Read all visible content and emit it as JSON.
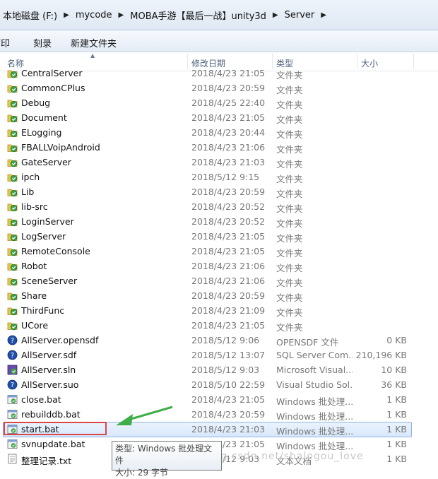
{
  "breadcrumb": [
    "本地磁盘 (F:)",
    "mycode",
    "MOBA手游【最后一战】unity3d",
    "Server"
  ],
  "toolbar": {
    "print": "打印",
    "burn": "刻录",
    "new_folder": "新建文件夹"
  },
  "columns": {
    "name": "名称",
    "date": "修改日期",
    "type": "类型",
    "size": "大小"
  },
  "files": [
    {
      "name": "CentralServer",
      "date": "2018/4/23 21:05",
      "type": "文件夹",
      "size": "",
      "icon": "folder-icon"
    },
    {
      "name": "CommonCPlus",
      "date": "2018/4/23 20:59",
      "type": "文件夹",
      "size": "",
      "icon": "folder-icon"
    },
    {
      "name": "Debug",
      "date": "2018/4/25 22:40",
      "type": "文件夹",
      "size": "",
      "icon": "folder-icon"
    },
    {
      "name": "Document",
      "date": "2018/4/23 21:05",
      "type": "文件夹",
      "size": "",
      "icon": "folder-icon"
    },
    {
      "name": "ELogging",
      "date": "2018/4/23 20:44",
      "type": "文件夹",
      "size": "",
      "icon": "folder-icon"
    },
    {
      "name": "FBALLVoipAndroid",
      "date": "2018/4/23 21:06",
      "type": "文件夹",
      "size": "",
      "icon": "folder-icon"
    },
    {
      "name": "GateServer",
      "date": "2018/4/23 21:03",
      "type": "文件夹",
      "size": "",
      "icon": "folder-icon"
    },
    {
      "name": "ipch",
      "date": "2018/5/12 9:15",
      "type": "文件夹",
      "size": "",
      "icon": "folder-icon"
    },
    {
      "name": "Lib",
      "date": "2018/4/23 20:59",
      "type": "文件夹",
      "size": "",
      "icon": "folder-icon"
    },
    {
      "name": "lib-src",
      "date": "2018/4/23 20:52",
      "type": "文件夹",
      "size": "",
      "icon": "folder-icon"
    },
    {
      "name": "LoginServer",
      "date": "2018/4/23 20:52",
      "type": "文件夹",
      "size": "",
      "icon": "folder-icon"
    },
    {
      "name": "LogServer",
      "date": "2018/4/23 21:05",
      "type": "文件夹",
      "size": "",
      "icon": "folder-icon"
    },
    {
      "name": "RemoteConsole",
      "date": "2018/4/23 21:05",
      "type": "文件夹",
      "size": "",
      "icon": "folder-icon"
    },
    {
      "name": "Robot",
      "date": "2018/4/23 21:06",
      "type": "文件夹",
      "size": "",
      "icon": "folder-icon"
    },
    {
      "name": "SceneServer",
      "date": "2018/4/23 21:06",
      "type": "文件夹",
      "size": "",
      "icon": "folder-icon"
    },
    {
      "name": "Share",
      "date": "2018/4/23 20:59",
      "type": "文件夹",
      "size": "",
      "icon": "folder-icon"
    },
    {
      "name": "ThirdFunc",
      "date": "2018/4/23 21:09",
      "type": "文件夹",
      "size": "",
      "icon": "folder-icon"
    },
    {
      "name": "UCore",
      "date": "2018/4/23 21:05",
      "type": "文件夹",
      "size": "",
      "icon": "folder-icon"
    },
    {
      "name": "AllServer.opensdf",
      "date": "2018/5/12 9:06",
      "type": "OPENSDF 文件",
      "size": "0 KB",
      "icon": "file-icon"
    },
    {
      "name": "AllServer.sdf",
      "date": "2018/5/12 13:07",
      "type": "SQL Server Com...",
      "size": "210,196 KB",
      "icon": "file-icon"
    },
    {
      "name": "AllServer.sln",
      "date": "2018/5/12 9:03",
      "type": "Microsoft Visual...",
      "size": "10 KB",
      "icon": "sln-icon"
    },
    {
      "name": "AllServer.suo",
      "date": "2018/5/10 22:59",
      "type": "Visual Studio Sol...",
      "size": "36 KB",
      "icon": "file-icon"
    },
    {
      "name": "close.bat",
      "date": "2018/4/23 21:05",
      "type": "Windows 批处理...",
      "size": "1 KB",
      "icon": "bat-icon"
    },
    {
      "name": "rebuilddb.bat",
      "date": "2018/4/23 20:59",
      "type": "Windows 批处理...",
      "size": "1 KB",
      "icon": "bat-icon"
    },
    {
      "name": "start.bat",
      "date": "2018/4/23 21:03",
      "type": "Windows 批处理...",
      "size": "1 KB",
      "icon": "bat-icon"
    },
    {
      "name": "svnupdate.bat",
      "date": "2018/4/23 21:05",
      "type": "Windows 批处理...",
      "size": "1 KB",
      "icon": "bat-icon"
    },
    {
      "name": "整理记录.txt",
      "date": "2018/5/12 9:03",
      "type": "文本文档",
      "size": "1 KB",
      "icon": "txt-icon"
    }
  ],
  "tooltip": {
    "line1": "类型: Windows 批处理文件",
    "line2": "大小: 29 字节"
  },
  "watermark": "https://blog.csdn.net/shalogou_love",
  "colors": {
    "selection": "#d8e8fb",
    "highlight_box": "#d84848",
    "arrow": "#3fae49"
  }
}
